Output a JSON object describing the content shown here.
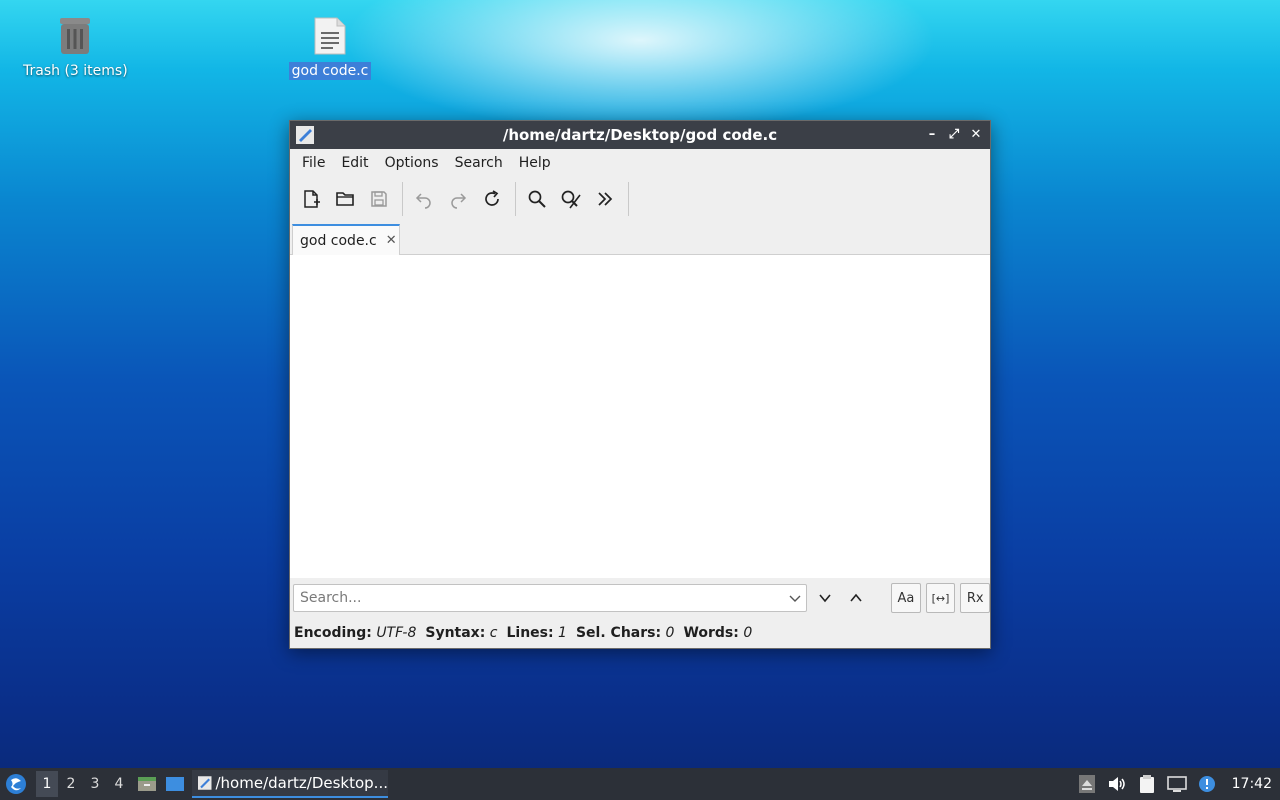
{
  "desktop": {
    "trash_label": "Trash (3 items)",
    "file_label": "god code.c"
  },
  "window": {
    "title": "/home/dartz/Desktop/god code.c",
    "controls": {
      "minimize": "–",
      "maximize": "⤢",
      "close": "✕"
    }
  },
  "menu": [
    "File",
    "Edit",
    "Options",
    "Search",
    "Help"
  ],
  "toolbar": {
    "icons": [
      "new-file-icon",
      "open-folder-icon",
      "save-icon",
      "undo-icon",
      "redo-icon",
      "reload-icon",
      "find-icon",
      "find-replace-icon",
      "more-icon"
    ]
  },
  "tab": {
    "label": "god code.c",
    "close": "✕"
  },
  "search": {
    "placeholder": "Search...",
    "value": "",
    "options": {
      "case": "Aa",
      "whole_word": "[↔]",
      "regex": "Rx"
    }
  },
  "status": {
    "encoding_label": "Encoding:",
    "encoding": "UTF-8",
    "syntax_label": "Syntax:",
    "syntax": "c",
    "lines_label": "Lines:",
    "lines": "1",
    "sel_label": "Sel. Chars:",
    "sel": "0",
    "words_label": "Words:",
    "words": "0"
  },
  "taskbar": {
    "workspaces": [
      "1",
      "2",
      "3",
      "4"
    ],
    "active_workspace": "1",
    "task_title": "/home/dartz/Desktop...",
    "clock": "17:42"
  },
  "colors": {
    "accent": "#3d8ee0",
    "titlebar": "#3b3f47",
    "taskbar": "#2c3038"
  }
}
